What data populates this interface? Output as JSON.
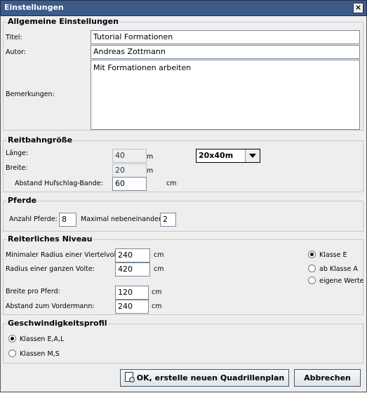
{
  "window": {
    "title": "Einstellungen",
    "close_symbol": "×"
  },
  "general": {
    "title": "Allgemeine Einstellungen",
    "titel_label": "Titel:",
    "titel_value": "Tutorial Formationen",
    "autor_label": "Autor:",
    "autor_value": "Andreas Zottmann",
    "bemerkungen_label": "Bemerkungen:",
    "bemerkungen_value": "Mit Formationen arbeiten"
  },
  "arena": {
    "title": "Reitbahngröße",
    "laenge_label": "Länge:",
    "laenge_value": "40",
    "laenge_unit": "m",
    "breite_label": "Breite:",
    "breite_value": "20",
    "breite_unit": "m",
    "abstand_label": "Abstand Hufschlag-Bande:",
    "abstand_value": "60",
    "abstand_unit": "cm",
    "size_selected": "20x40m"
  },
  "horses": {
    "title": "Pferde",
    "count_label": "Anzahl Pferde:",
    "count_value": "8",
    "max_label": "Maximal nebeneinander:",
    "max_value": "2"
  },
  "level": {
    "title": "Reiterliches Niveau",
    "r1_label": "Minimaler Radius einer Viertelvolte:",
    "r1_value": "240",
    "r1_unit": "cm",
    "r2_label": "Radius einer ganzen Volte:",
    "r2_value": "420",
    "r2_unit": "cm",
    "b_label": "Breite pro Pferd:",
    "b_value": "120",
    "b_unit": "cm",
    "d_label": "Abstand zum Vordermann:",
    "d_value": "240",
    "d_unit": "cm",
    "options": [
      "Klasse E",
      "ab Klasse A",
      "eigene Werte"
    ],
    "selected_option": "Klasse E"
  },
  "speed": {
    "title": "Geschwindigkeitsprofil",
    "options": [
      "Klassen E,A,L",
      "Klassen M,S"
    ],
    "selected_option": "Klassen E,A,L"
  },
  "buttons": {
    "ok_label": "OK, erstelle neuen Quadrillenplan",
    "cancel_label": "Abbrechen"
  }
}
